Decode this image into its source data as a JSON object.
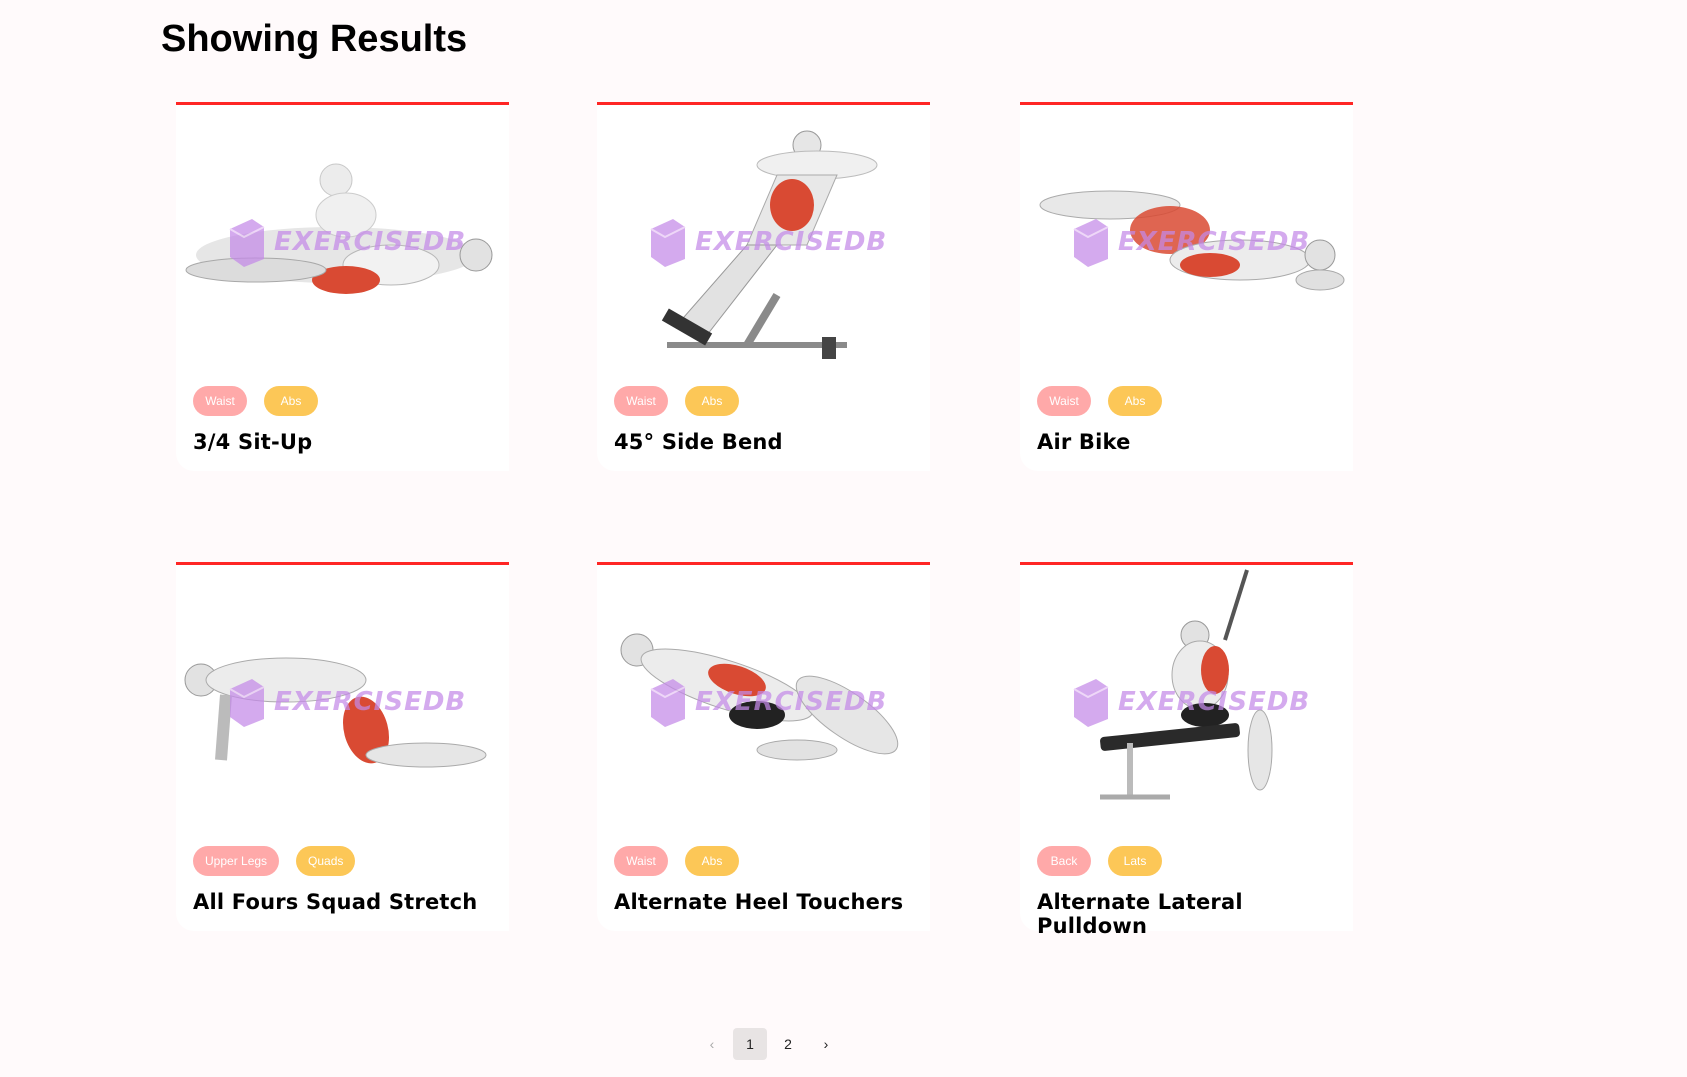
{
  "page": {
    "title": "Showing Results"
  },
  "watermark": "EXERCISEDB",
  "cards": [
    {
      "name": "3/4 Sit-Up",
      "body_part": "Waist",
      "target": "Abs"
    },
    {
      "name": "45° Side Bend",
      "body_part": "Waist",
      "target": "Abs"
    },
    {
      "name": "Air Bike",
      "body_part": "Waist",
      "target": "Abs"
    },
    {
      "name": "All Fours Squad Stretch",
      "body_part": "Upper Legs",
      "target": "Quads"
    },
    {
      "name": "Alternate Heel Touchers",
      "body_part": "Waist",
      "target": "Abs"
    },
    {
      "name": "Alternate Lateral Pulldown",
      "body_part": "Back",
      "target": "Lats"
    }
  ],
  "pagination": {
    "prev": "‹",
    "pages": [
      "1",
      "2"
    ],
    "current": "1",
    "next": "›"
  },
  "colors": {
    "accent": "#ff2625",
    "tag_body": "#ffa9a9",
    "tag_target": "#fcc757",
    "watermark": "#c48ae8",
    "muscle_highlight": "#d94a33"
  }
}
